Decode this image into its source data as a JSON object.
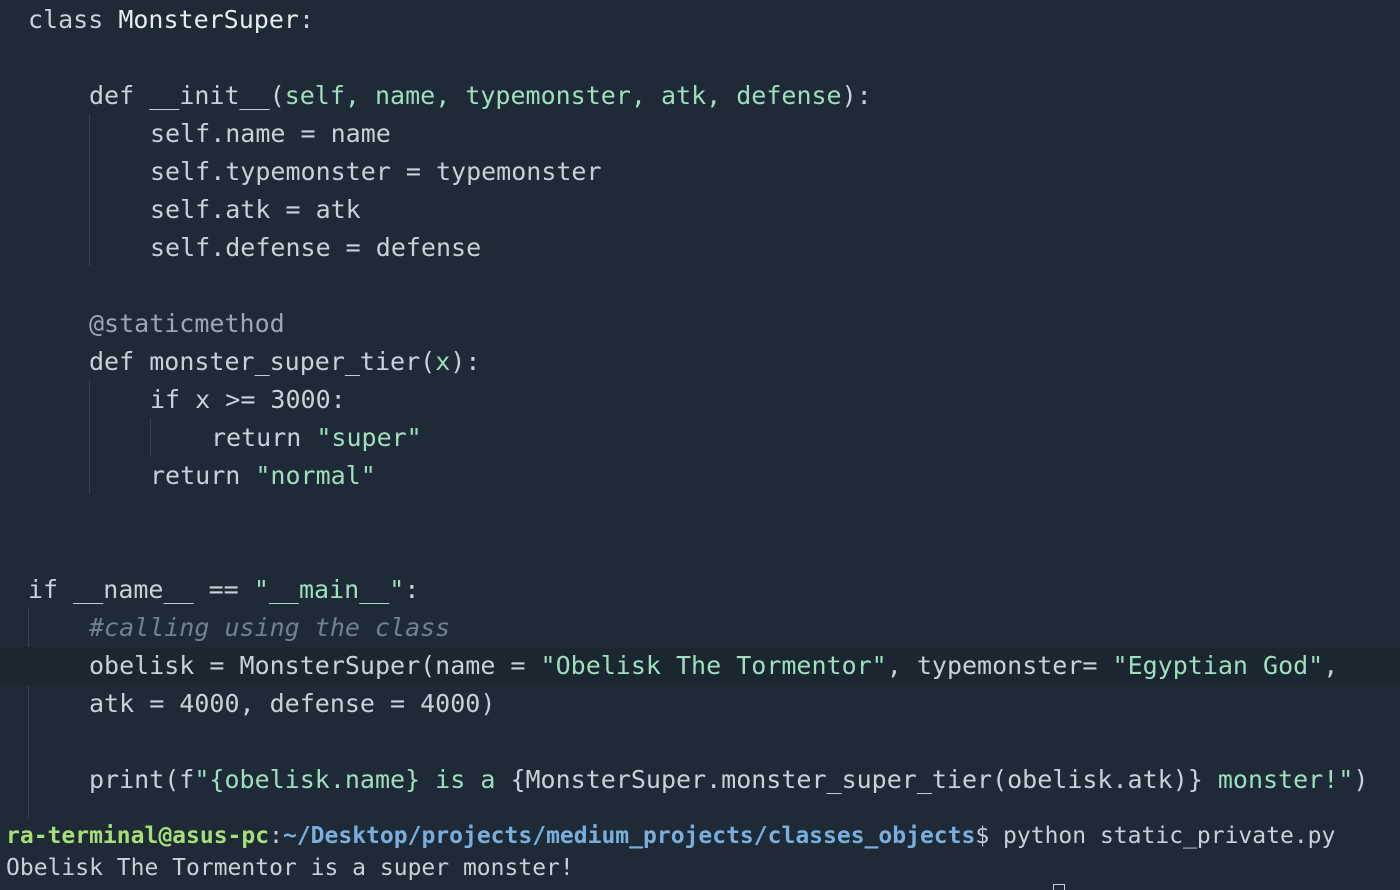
{
  "code": {
    "l1": {
      "kw": "class",
      "name": "MonsterSuper",
      "end": ":"
    },
    "l2": {
      "kw": "def",
      "fn": "__init__",
      "open": "(",
      "params": "self, name, typemonster, atk, defense",
      "close": "):"
    },
    "l3": {
      "text": "self.name = name"
    },
    "l4": {
      "text": "self.typemonster = typemonster"
    },
    "l5": {
      "text": "self.atk = atk"
    },
    "l6": {
      "text": "self.defense = defense"
    },
    "l7": {
      "decorator": "@staticmethod"
    },
    "l8": {
      "kw": "def",
      "fn": "monster_super_tier",
      "open": "(",
      "param": "x",
      "close": "):"
    },
    "l9": {
      "kw": "if",
      "rest": "x >= 3000:"
    },
    "l10": {
      "kw": "return",
      "str": "\"super\""
    },
    "l11": {
      "kw": "return",
      "str": "\"normal\""
    },
    "l12": {
      "kw": "if",
      "mid": "__name__ ==",
      "str": "\"__main__\"",
      "end": ":"
    },
    "l13": {
      "comment": "#calling using the class"
    },
    "l14": {
      "pre": "obelisk = MonsterSuper(name = ",
      "str1": "\"Obelisk The Tormentor\"",
      "mid": ", typemonster= ",
      "str2": "\"Egyptian God\"",
      "end": ","
    },
    "l15": {
      "text": "atk = 4000, defense = 4000)"
    },
    "l16": {
      "pre": "print(f",
      "str1": "\"{obelisk.name} is a ",
      "mid": "{MonsterSuper.monster_super_tier(obelisk.atk)}",
      "str2": " monster!\"",
      "end": ")"
    }
  },
  "terminal": {
    "user": "ra-terminal@asus-pc",
    "sep": ":",
    "path": "~/Desktop/projects/medium_projects/classes_objects",
    "dollar": "$",
    "command": " python static_private.py",
    "output": "Obelisk The Tormentor is a super monster!"
  }
}
